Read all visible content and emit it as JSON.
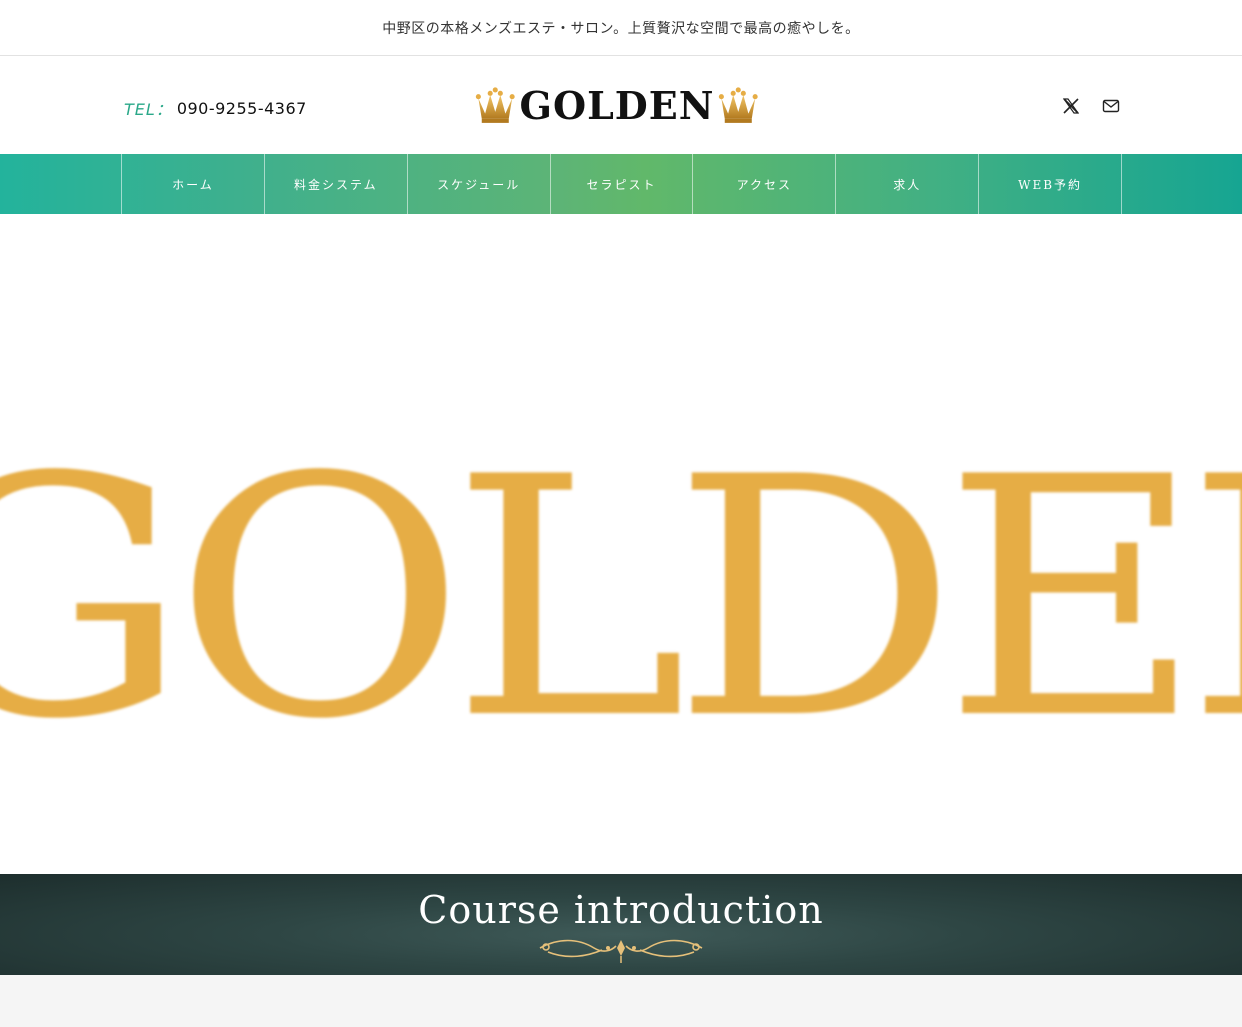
{
  "topbar": {
    "tagline": "中野区の本格メンズエステ・サロン。上質贅沢な空間で最高の癒やしを。"
  },
  "header": {
    "tel_label": "TEL：",
    "tel_number": "090-9255-4367",
    "logo_text": "GOLDEN",
    "social": [
      {
        "icon": "x-twitter-icon"
      },
      {
        "icon": "mail-icon"
      }
    ]
  },
  "nav": {
    "items": [
      {
        "label": "ホーム"
      },
      {
        "label": "料金システム"
      },
      {
        "label": "スケジュール"
      },
      {
        "label": "セラピスト"
      },
      {
        "label": "アクセス"
      },
      {
        "label": "求人"
      },
      {
        "label": "WEB予約"
      }
    ]
  },
  "hero": {
    "text": "GOLDEN"
  },
  "section": {
    "title": "Course introduction"
  },
  "colors": {
    "accent": "#2aa889",
    "gold": "#e6ad45",
    "dark_band": "#2e4644"
  }
}
